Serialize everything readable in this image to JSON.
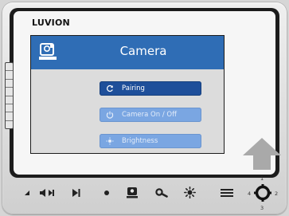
{
  "brand": {
    "name": "LUVION"
  },
  "screen": {
    "title": "Camera",
    "menu": [
      {
        "label": "Pairing",
        "icon": "pairing-icon",
        "state": "selected"
      },
      {
        "label": "Camera On / Off",
        "icon": "power-icon",
        "state": "normal"
      },
      {
        "label": "Brightness",
        "icon": "brightness-icon",
        "state": "normal"
      }
    ]
  },
  "toolbar": {
    "buttons": [
      {
        "icon": "volume-icon"
      },
      {
        "icon": "speaker-talk-icon"
      },
      {
        "icon": "play-pause-icon"
      },
      {
        "icon": "dot-icon"
      },
      {
        "icon": "camera-select-icon"
      },
      {
        "icon": "zoom-icon"
      },
      {
        "icon": "brightness-sun-icon"
      },
      {
        "icon": "menu-icon"
      }
    ],
    "dpad": {
      "labels": {
        "top": "1",
        "left": "4",
        "right": "2",
        "bottom": "3"
      }
    }
  },
  "colors": {
    "title_bar": "#2f6db5",
    "menu_selected": "#1e4f9a",
    "menu_normal": "#7aa6e2",
    "content_bg": "#dcdcdc",
    "arrow": "#a9a9a9"
  }
}
